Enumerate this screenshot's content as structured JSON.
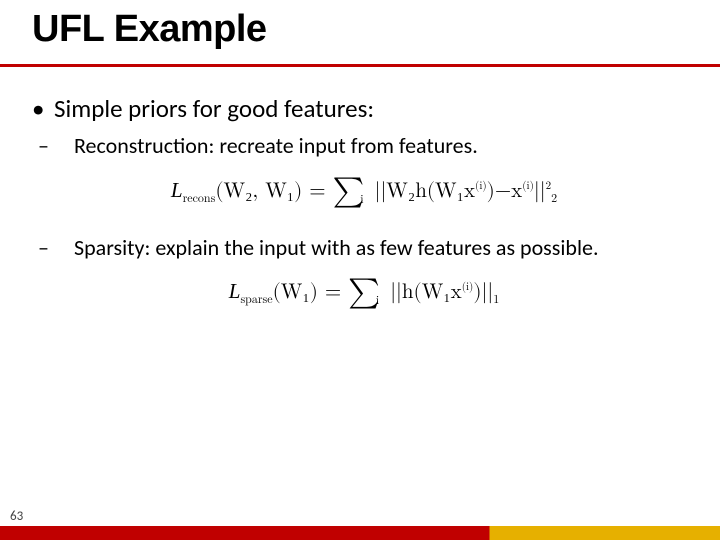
{
  "title": "UFL Example",
  "bullets": {
    "main": "Simple priors for good features:",
    "sub1": "Reconstruction:  recreate input from features.",
    "sub2": "Sparsity:  explain the input with as few features as possible."
  },
  "equations": {
    "recons_label": "recons",
    "sparse_label": "sparse",
    "recons_args": "(W₂, W₁)",
    "sparse_args": "(W₁)",
    "recons_body_l": "||W₂h(W₁x",
    "recons_body_m": "−x",
    "recons_body_r": "||",
    "norm22": "2",
    "sparse_body_l": "||h(W₁x",
    "sparse_body_r": ")||",
    "norm1": "1",
    "sup_i": "(i)",
    "sum_idx": "i"
  },
  "page_number": "63"
}
